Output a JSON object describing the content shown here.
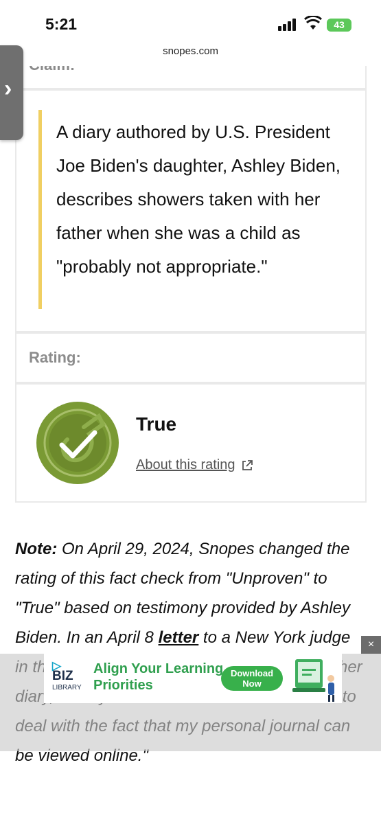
{
  "status_bar": {
    "time": "5:21",
    "battery": "43",
    "url": "snopes.com"
  },
  "side_tab": {
    "label": "›"
  },
  "claim": {
    "partial_heading": "Claim:",
    "text": "A diary authored by U.S. President Joe Biden's daughter, Ashley Biden, describes showers taken with her father when she was a child as \"probably not appropriate.\""
  },
  "rating": {
    "label": "Rating:",
    "value": "True",
    "about_link": "About this rating",
    "badge_color": "#7a9a34"
  },
  "note": {
    "label": "Note:",
    "text_part1": " On April 29, 2024, Snopes changed the rating of this fact check from \"Unproven\" to \"True\" based on testimony provided by Ashley Biden. In an April 8 ",
    "link": "letter",
    "text_part2": " to a New York ",
    "hidden_text": "judge in the case against the two people who sold her diary, Ashley",
    "text_part3": " Biden wrote \"I will forever have to deal with the fact that my personal journal can be viewed online.\""
  },
  "ad": {
    "close": "×",
    "logo_line1": "▷",
    "logo_line2": "BIZ",
    "logo_line3": "LIBRARY",
    "headline": "Align Your Learning Priorities",
    "cta": "Download Now",
    "accent": "#38b04b"
  }
}
